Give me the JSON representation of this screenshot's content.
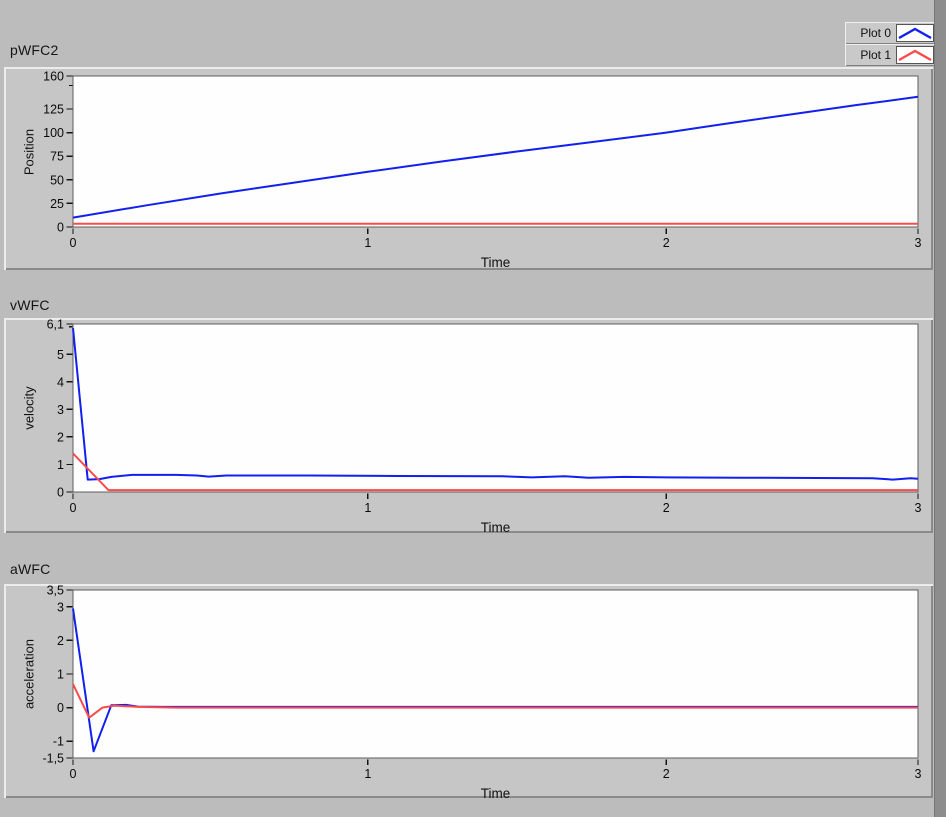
{
  "window": {
    "background_color": "#bcbcbc",
    "panel_color": "#c6c6c6",
    "plot_background": "#fefefe"
  },
  "legend": {
    "items": [
      {
        "label": "Plot 0",
        "color": "#1120ee"
      },
      {
        "label": "Plot 1",
        "color": "#f84b4b"
      }
    ]
  },
  "chart_data": [
    {
      "type": "line",
      "title": "pWFC2",
      "ylabel": "Position",
      "xlabel": "Time",
      "xlim": [
        0,
        3
      ],
      "ylim": [
        0,
        160
      ],
      "grid": false,
      "legend_position": "top-right",
      "yticks": [
        {
          "value": 0,
          "label": "0"
        },
        {
          "value": 25,
          "label": "25"
        },
        {
          "value": 50,
          "label": "50"
        },
        {
          "value": 75,
          "label": "75"
        },
        {
          "value": 100,
          "label": "100"
        },
        {
          "value": 125,
          "label": "125"
        },
        {
          "value": 160,
          "label": "160"
        }
      ],
      "yminorticks": [
        150
      ],
      "xticks": [
        {
          "value": 0,
          "label": "0"
        },
        {
          "value": 1,
          "label": "1"
        },
        {
          "value": 2,
          "label": "2"
        },
        {
          "value": 3,
          "label": "3"
        }
      ],
      "series": [
        {
          "name": "Plot 0",
          "color": "#1120ee",
          "points": [
            [
              0,
              10
            ],
            [
              0.25,
              23
            ],
            [
              0.5,
              35.5
            ],
            [
              0.75,
              47
            ],
            [
              1,
              58.5
            ],
            [
              1.25,
              69.5
            ],
            [
              1.5,
              80
            ],
            [
              1.75,
              90
            ],
            [
              2,
              100
            ],
            [
              2.25,
              110
            ],
            [
              2.5,
              119.5
            ],
            [
              2.75,
              129
            ],
            [
              3,
              138
            ]
          ]
        },
        {
          "name": "Plot 1",
          "color": "#f84b4b",
          "points": [
            [
              0,
              3.5
            ],
            [
              3,
              3.5
            ]
          ]
        }
      ]
    },
    {
      "type": "line",
      "title": "vWFC",
      "ylabel": "velocity",
      "xlabel": "Time",
      "xlim": [
        0,
        3
      ],
      "ylim": [
        0,
        6.1
      ],
      "grid": false,
      "yticks": [
        {
          "value": 0,
          "label": "0"
        },
        {
          "value": 1,
          "label": "1"
        },
        {
          "value": 2,
          "label": "2"
        },
        {
          "value": 3,
          "label": "3"
        },
        {
          "value": 4,
          "label": "4"
        },
        {
          "value": 5,
          "label": "5"
        },
        {
          "value": 6.1,
          "label": "6,1"
        }
      ],
      "yminorticks": [
        6
      ],
      "xticks": [
        {
          "value": 0,
          "label": "0"
        },
        {
          "value": 1,
          "label": "1"
        },
        {
          "value": 2,
          "label": "2"
        },
        {
          "value": 3,
          "label": "3"
        }
      ],
      "series": [
        {
          "name": "Plot 0",
          "color": "#1120ee",
          "points": [
            [
              0,
              5.95
            ],
            [
              0.05,
              0.45
            ],
            [
              0.09,
              0.47
            ],
            [
              0.13,
              0.55
            ],
            [
              0.2,
              0.62
            ],
            [
              0.35,
              0.62
            ],
            [
              0.42,
              0.6
            ],
            [
              0.46,
              0.56
            ],
            [
              0.52,
              0.6
            ],
            [
              0.8,
              0.6
            ],
            [
              1.1,
              0.58
            ],
            [
              1.45,
              0.57
            ],
            [
              1.55,
              0.53
            ],
            [
              1.66,
              0.57
            ],
            [
              1.74,
              0.52
            ],
            [
              1.86,
              0.55
            ],
            [
              2,
              0.53
            ],
            [
              2.3,
              0.52
            ],
            [
              2.6,
              0.51
            ],
            [
              2.82,
              0.5
            ],
            [
              2.9,
              0.45
            ],
            [
              2.97,
              0.5
            ],
            [
              3,
              0.48
            ]
          ]
        },
        {
          "name": "Plot 1",
          "color": "#f84b4b",
          "points": [
            [
              0,
              1.4
            ],
            [
              0.12,
              0.07
            ],
            [
              3,
              0.07
            ]
          ]
        }
      ]
    },
    {
      "type": "line",
      "title": "aWFC",
      "ylabel": "acceleration",
      "xlabel": "Time",
      "xlim": [
        0,
        3
      ],
      "ylim": [
        -1.5,
        3.5
      ],
      "grid": false,
      "yticks": [
        {
          "value": -1.5,
          "label": "-1,5"
        },
        {
          "value": -1,
          "label": "-1"
        },
        {
          "value": 0,
          "label": "0"
        },
        {
          "value": 1,
          "label": "1"
        },
        {
          "value": 2,
          "label": "2"
        },
        {
          "value": 3,
          "label": "3"
        },
        {
          "value": 3.5,
          "label": "3,5"
        }
      ],
      "yminorticks": [],
      "xticks": [
        {
          "value": 0,
          "label": "0"
        },
        {
          "value": 1,
          "label": "1"
        },
        {
          "value": 2,
          "label": "2"
        },
        {
          "value": 3,
          "label": "3"
        }
      ],
      "series": [
        {
          "name": "Plot 0",
          "color": "#1120ee",
          "points": [
            [
              0,
              2.95
            ],
            [
              0.07,
              -1.3
            ],
            [
              0.13,
              0.07
            ],
            [
              0.18,
              0.08
            ],
            [
              0.22,
              0.03
            ],
            [
              0.3,
              0.02
            ],
            [
              3,
              0.02
            ]
          ]
        },
        {
          "name": "Plot 1",
          "color": "#f84b4b",
          "points": [
            [
              0,
              0.7
            ],
            [
              0.055,
              -0.3
            ],
            [
              0.1,
              0.0
            ],
            [
              0.14,
              0.06
            ],
            [
              0.22,
              0.02
            ],
            [
              0.35,
              0.0
            ],
            [
              3,
              0.0
            ]
          ]
        }
      ]
    }
  ]
}
